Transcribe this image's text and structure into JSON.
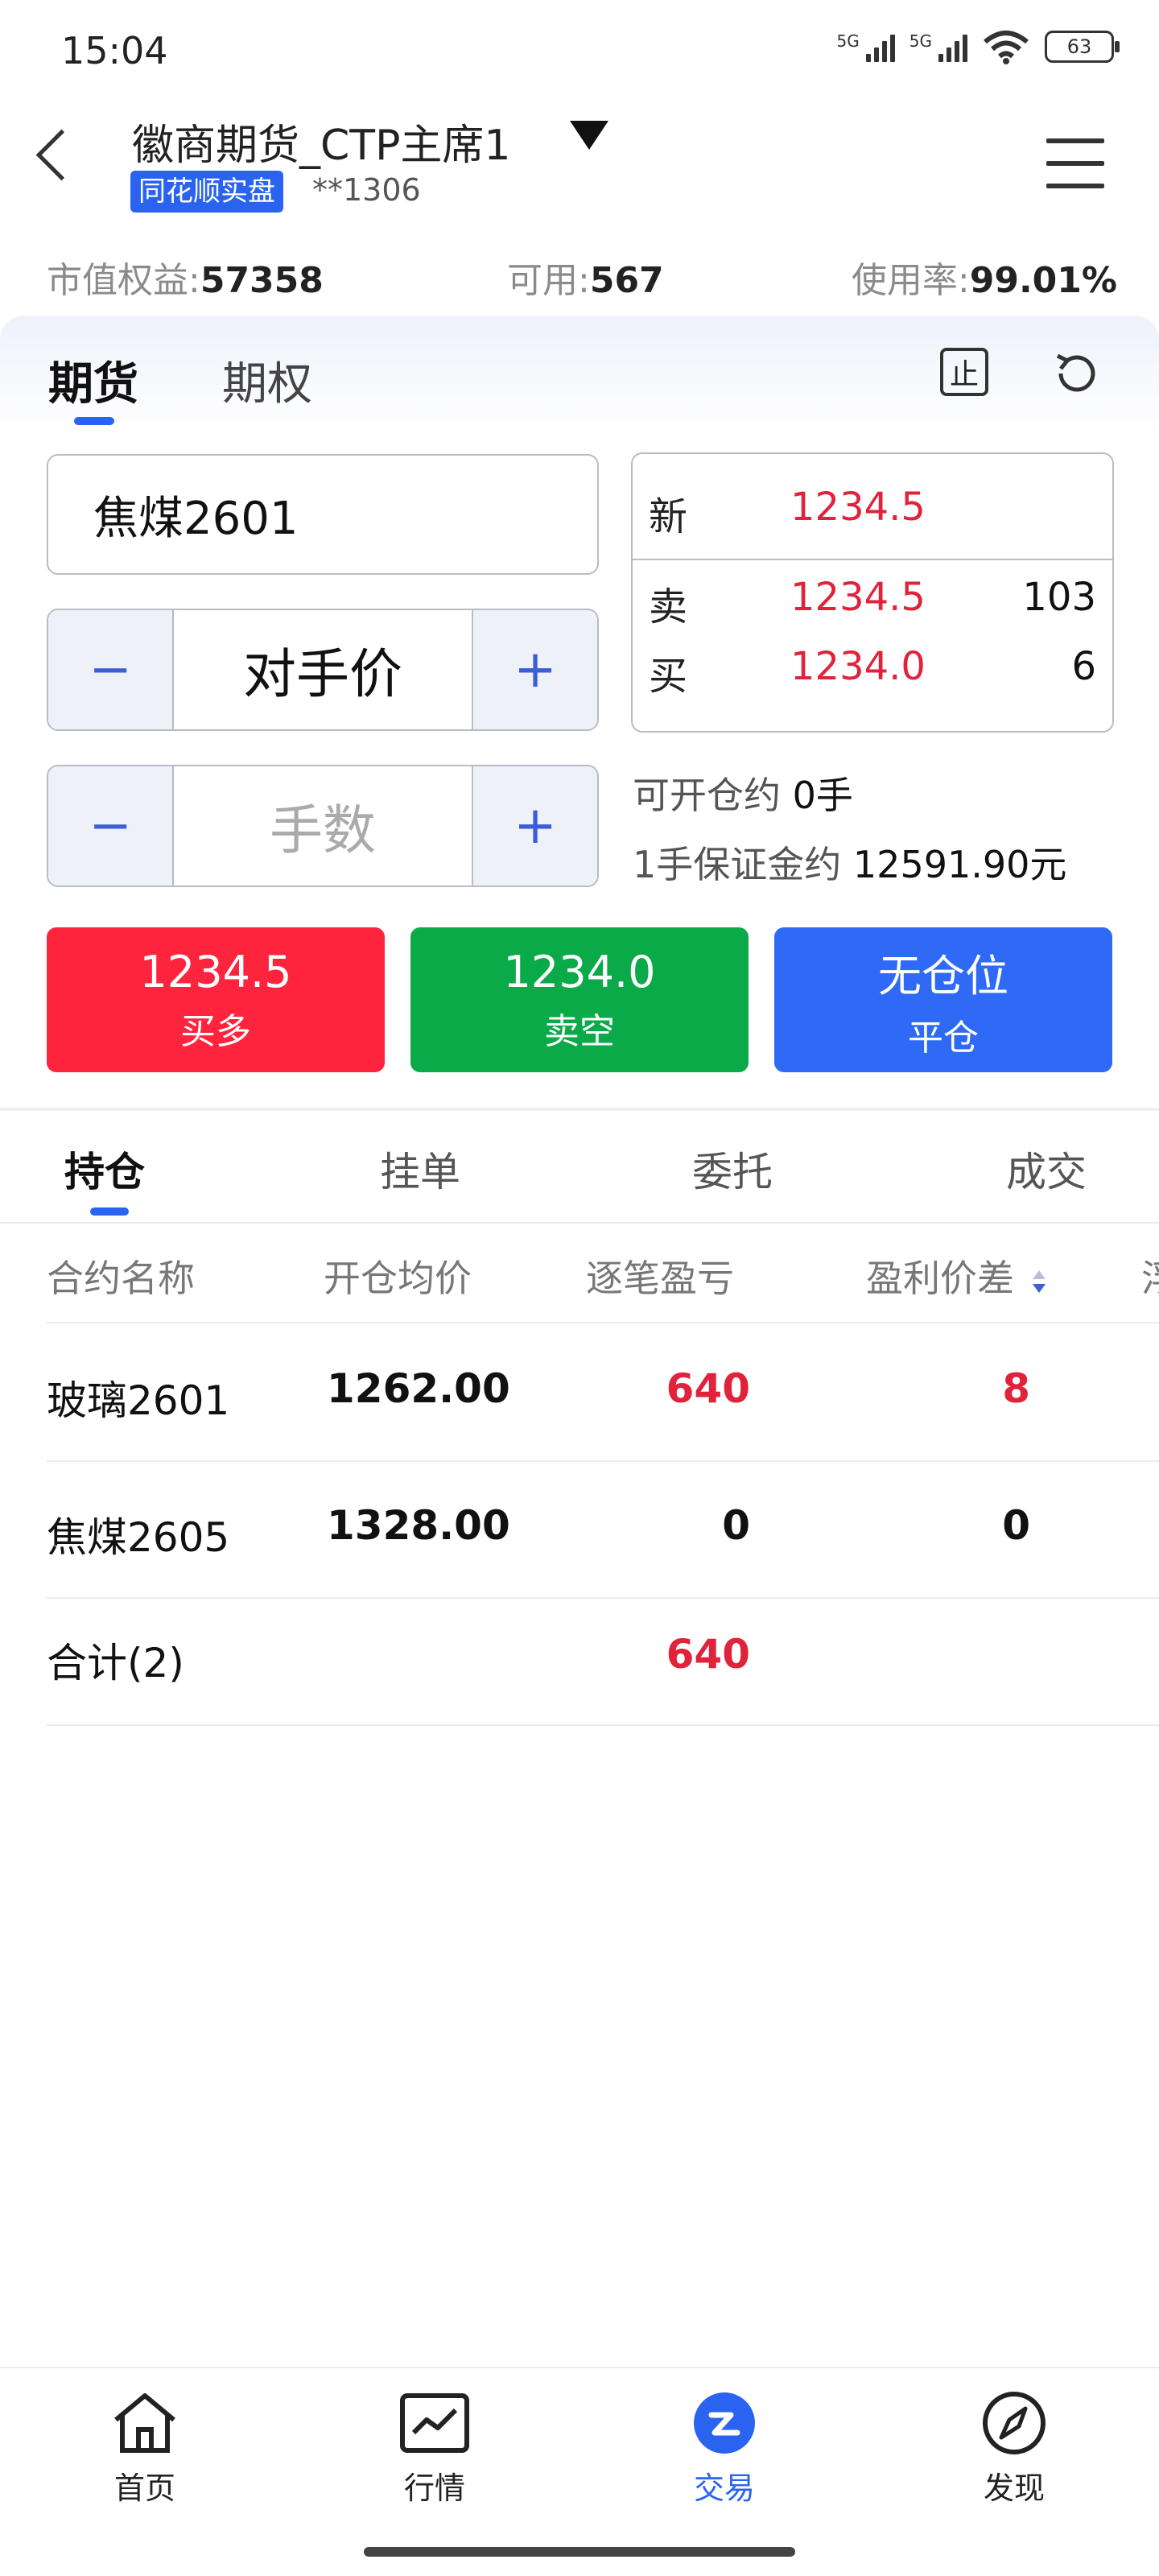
{
  "status_bar": {
    "time": "15:04",
    "network1": "5G",
    "network2": "5G",
    "battery": "63"
  },
  "header": {
    "title": "徽商期货_CTP主席1",
    "source_badge": "同花顺实盘",
    "account": "**1306"
  },
  "equity": {
    "market_equity_label": "市值权益:",
    "market_equity_value": "57358",
    "available_label": "可用:",
    "available_value": "567",
    "usage_label": "使用率:",
    "usage_value": "99.01%"
  },
  "product_tabs": [
    "期货",
    "期权"
  ],
  "stop_icon_glyph": "止",
  "order": {
    "contract": "焦煤2601",
    "price_mode": "对手价",
    "quantity_placeholder": "手数",
    "minus": "−",
    "plus": "+"
  },
  "quote": {
    "last_label": "新",
    "last_price": "1234.5",
    "ask_label": "卖",
    "ask_price": "1234.5",
    "ask_volume": "103",
    "bid_label": "买",
    "bid_price": "1234.0",
    "bid_volume": "6"
  },
  "open_info": {
    "openable_label": "可开仓约",
    "openable_value": "0手",
    "margin_label": "1手保证金约",
    "margin_value": "12591.90元"
  },
  "actions": {
    "buy_price": "1234.5",
    "buy_label": "买多",
    "sell_price": "1234.0",
    "sell_label": "卖空",
    "close_top": "无仓位",
    "close_label": "平仓"
  },
  "position_tabs": [
    "持仓",
    "挂单",
    "委托",
    "成交"
  ],
  "table": {
    "headers": [
      "合约名称",
      "开仓均价",
      "逐笔盈亏",
      "盈利价差",
      "浮"
    ],
    "rows": [
      {
        "name": "玻璃2601",
        "avg_price": "1262.00",
        "pnl": "640",
        "spread": "8"
      },
      {
        "name": "焦煤2605",
        "avg_price": "1328.00",
        "pnl": "0",
        "spread": "0"
      }
    ],
    "total_label": "合计(2)",
    "total_pnl": "640"
  },
  "bottom_nav": [
    "首页",
    "行情",
    "交易",
    "发现"
  ],
  "colors": {
    "accent": "#2a63f0",
    "up": "#ff243e",
    "down": "#0aaa48",
    "close": "#2e6af5",
    "price_red": "#e0233a"
  }
}
